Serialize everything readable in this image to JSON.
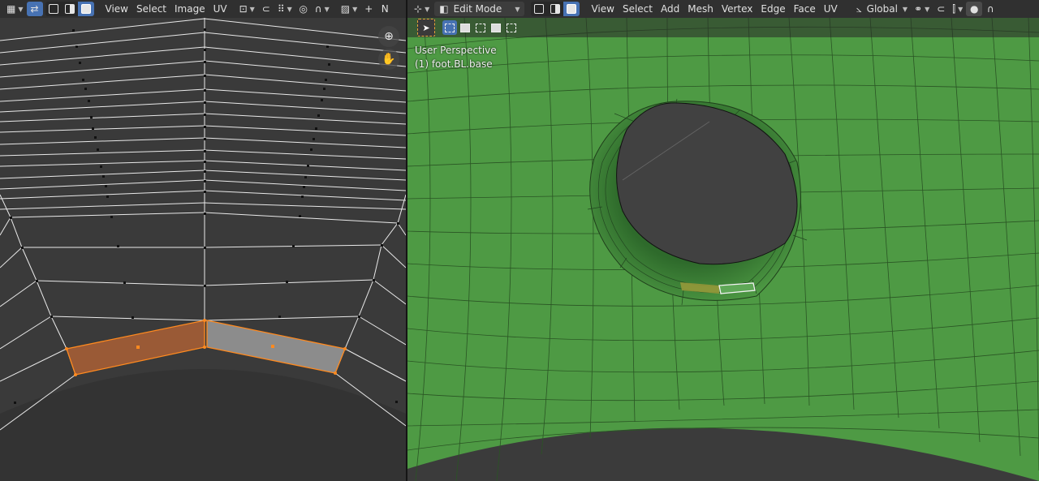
{
  "uv_editor": {
    "header": {
      "editor_type_icon": "uv-editor-icon",
      "sync_icon": "uv-sync-selection-icon",
      "menus": [
        "View",
        "Select",
        "Image",
        "UV"
      ],
      "pivot_icon": "pivot-point-icon",
      "snap_icon": "snapping-icon",
      "proportional_icon": "proportional-editing-icon",
      "image_icon": "image-browse-icon",
      "new_label": "+",
      "sidebar_label": "N"
    },
    "gizmos": [
      "zoom-icon",
      "pan-hand-icon"
    ]
  },
  "viewport": {
    "header": {
      "editor_type_icon": "3d-viewport-icon",
      "mode_label": "Edit Mode",
      "menus": [
        "View",
        "Select",
        "Add",
        "Mesh",
        "Vertex",
        "Edge",
        "Face",
        "UV"
      ],
      "transform_orientation": "Global"
    },
    "overlay": {
      "perspective": "User Perspective",
      "object": "(1) foot.BL.base"
    }
  },
  "colors": {
    "mesh_face": "#4e9a44",
    "uv_background": "#3a3a3a",
    "uv_selected_face": "#b0643a",
    "uv_selected_edge": "#ff8a1f",
    "header_bg": "#303030",
    "active_blue": "#4772b3"
  }
}
